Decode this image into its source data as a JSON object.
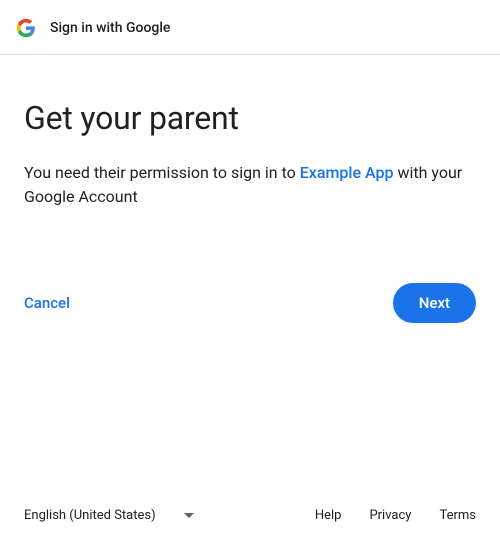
{
  "header": {
    "title": "Sign in with Google"
  },
  "main": {
    "heading": "Get your parent",
    "subtitle_prefix": "You need their permission to sign in to ",
    "app_name": "Example App",
    "subtitle_suffix": " with your Google Account"
  },
  "buttons": {
    "cancel": "Cancel",
    "next": "Next"
  },
  "footer": {
    "language": "English (United States)",
    "help": "Help",
    "privacy": "Privacy",
    "terms": "Terms"
  }
}
